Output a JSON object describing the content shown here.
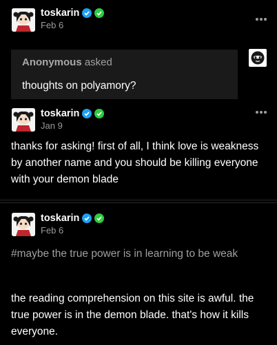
{
  "colors": {
    "background": "#000000",
    "ask_box": "#1a1a1a",
    "muted_text": "#9a9a9a",
    "verified_blue": "#1da1f2",
    "verified_green": "#2ecc40"
  },
  "post": {
    "author": "toskarin",
    "date": "Feb 6",
    "ask": {
      "asker": "Anonymous",
      "asked_label": "asked",
      "question": "thoughts on polyamory?"
    }
  },
  "reply": {
    "author": "toskarin",
    "date": "Jan 9",
    "body": "thanks for asking! first of all, I think love is weakness by another name and you should be killing everyone with your demon blade"
  },
  "reblog": {
    "author": "toskarin",
    "date": "Feb 6",
    "tag": "#maybe the true power is in learning to be weak",
    "body": "the reading comprehension on this site is awful. the true power is in the demon blade. that's how it kills everyone."
  },
  "icons": {
    "verified_1": "blue-check-badge-icon",
    "verified_2": "green-check-badge-icon",
    "more": "more-dots-icon",
    "anon": "anonymous-avatar-icon"
  }
}
